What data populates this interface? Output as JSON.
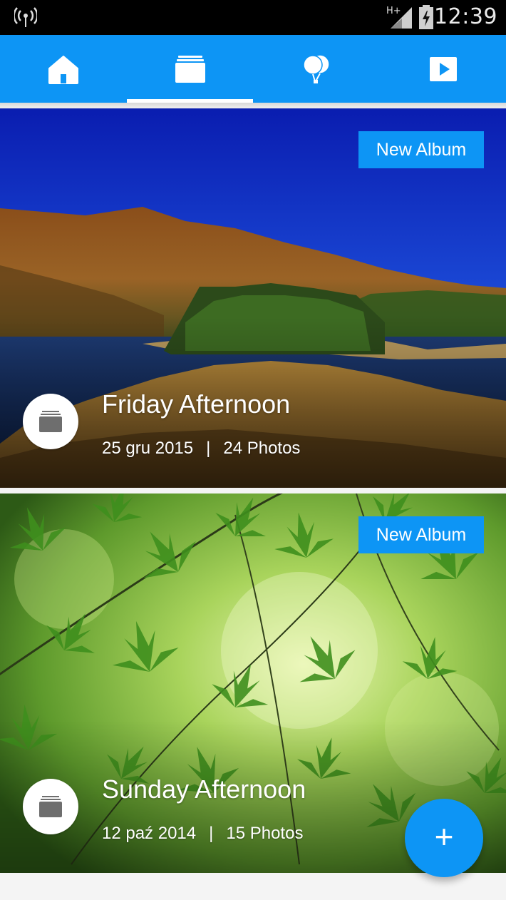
{
  "status_bar": {
    "time": "12:39",
    "network_label": "H+",
    "icons": [
      "wifi-tethering-icon",
      "signal-icon",
      "battery-icon"
    ]
  },
  "nav": {
    "tabs": [
      {
        "icon": "home-icon",
        "active": false
      },
      {
        "icon": "albums-icon",
        "active": true
      },
      {
        "icon": "balloons-icon",
        "active": false
      },
      {
        "icon": "video-play-icon",
        "active": false
      }
    ]
  },
  "albums": [
    {
      "title": "Friday Afternoon",
      "date": "25 gru 2015",
      "separator": "|",
      "photo_count": "24 Photos",
      "badge": "New Album",
      "icon": "album-stack-icon"
    },
    {
      "title": "Sunday Afternoon",
      "date": "12 paź 2014",
      "separator": "|",
      "photo_count": "15 Photos",
      "badge": "New Album",
      "icon": "album-stack-icon"
    }
  ],
  "fab": {
    "label": "+"
  },
  "colors": {
    "accent": "#0d95f5",
    "status_bar": "#000000",
    "background": "#f4f4f4"
  }
}
